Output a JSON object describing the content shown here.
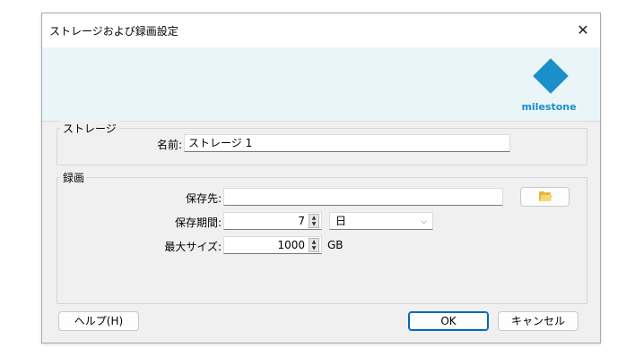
{
  "dialog": {
    "title": "ストレージおよび録画設定",
    "close_symbol": "✕"
  },
  "brand": {
    "logo_text": "milestone",
    "logo_color": "#1a8fc9",
    "logo_icon": "milestone-diamond-icon"
  },
  "storage": {
    "group_label": "ストレージ",
    "name_label": "名前:",
    "name_value": "ストレージ 1"
  },
  "recording": {
    "group_label": "録画",
    "path_label": "保存先:",
    "path_value": "",
    "browse_icon": "folder-open-icon",
    "retention_label": "保存期間:",
    "retention_value": "7",
    "retention_unit": "日",
    "maxsize_label": "最大サイズ:",
    "maxsize_value": "1000",
    "maxsize_unit": "GB"
  },
  "buttons": {
    "help": "ヘルプ(H)",
    "ok": "OK",
    "cancel": "キャンセル"
  },
  "spinner": {
    "up_symbol": "▲",
    "down_symbol": "▼"
  },
  "combo_arrow": "⌵",
  "colors": {
    "accent": "#0067c0",
    "banner_bg": "#eaf5f8",
    "dialog_bg": "#f0f0f0"
  }
}
